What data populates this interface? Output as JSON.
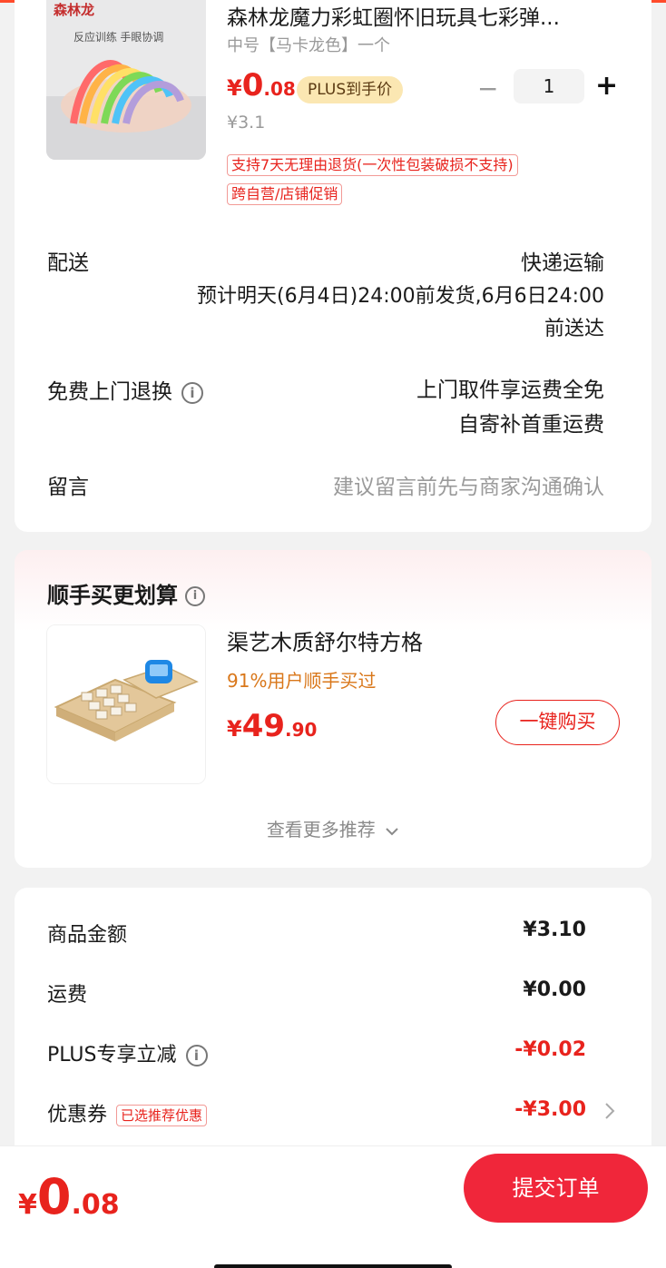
{
  "product": {
    "brand_logo": "森林龙",
    "brand_slogan": "反应训练 手眼协调",
    "title": "森林龙魔力彩虹圈怀旧玩具七彩弹...",
    "spec": "中号【马卡龙色】一个",
    "price_currency": "¥",
    "price_int": "0",
    "price_dec": ".08",
    "plus_tag": "PLUS到手价",
    "original_price": "¥3.1",
    "quantity": "1",
    "minus_symbol": "−",
    "plus_symbol": "+",
    "tags": [
      "支持7天无理由退货(一次性包装破损不支持)",
      "跨自营/店铺促销"
    ]
  },
  "delivery": {
    "label": "配送",
    "method": "快递运输",
    "estimate_line1": "预计明天(6月4日)24:00前发货,6月6日24:00",
    "estimate_line2": "前送达"
  },
  "return_service": {
    "label": "免费上门退换",
    "line1": "上门取件享运费全免",
    "line2": "自寄补首重运费"
  },
  "message": {
    "label": "留言",
    "placeholder": "建议留言前先与商家沟通确认"
  },
  "recommend": {
    "title": "顺手买更划算",
    "item_name": "渠艺木质舒尔特方格",
    "item_stat": "91%用户顺手买过",
    "price_currency": "¥",
    "price_int": "49",
    "price_dec": ".90",
    "buy_label": "一键购买",
    "more_label": "查看更多推荐"
  },
  "summary": {
    "rows": [
      {
        "label": "商品金额",
        "value": "¥3.10"
      },
      {
        "label": "运费",
        "value": "¥0.00"
      },
      {
        "label": "PLUS专享立减",
        "value": "-¥0.02"
      },
      {
        "label": "优惠券",
        "value": "-¥3.00"
      }
    ],
    "coupon_tag": "已选推荐优惠"
  },
  "bottom_bar": {
    "price_currency": "¥",
    "price_int": "0",
    "price_dec": ".08",
    "submit_label": "提交订单"
  },
  "colors": {
    "accent_red": "#e8231d",
    "submit_bg": "#f0263a",
    "plus_tag_bg": "#fbe7b2",
    "stat_orange": "#d9771a"
  }
}
